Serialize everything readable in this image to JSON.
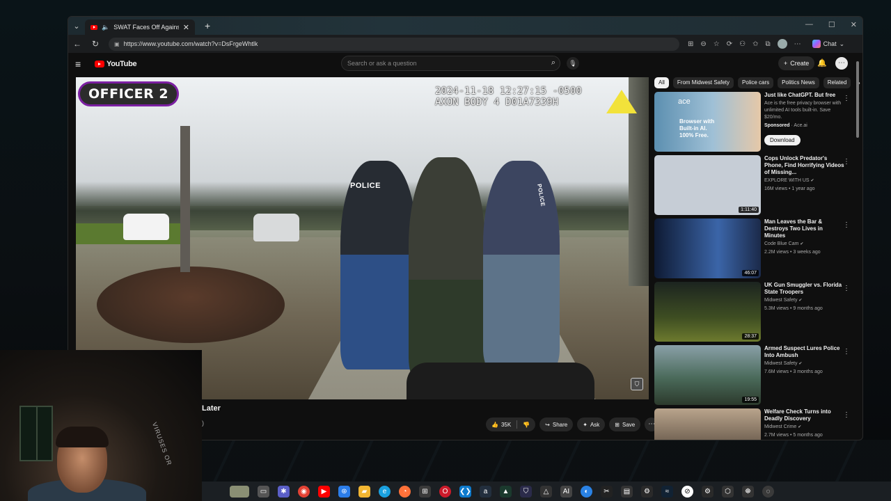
{
  "browser": {
    "tab_title": "SWAT Faces Off Against Killer",
    "tab_close": "✕",
    "new_tab": "+",
    "url": "https://www.youtube.com/watch?v=DsFrgeWhtlk",
    "chat_label": "Chat",
    "window_controls": [
      "—",
      "☐",
      "✕"
    ]
  },
  "youtube": {
    "logo_text": "YouTube",
    "search_placeholder": "Search or ask a question",
    "create_label": "Create"
  },
  "video": {
    "officer_label": "OFFICER 2",
    "timestamp": "2024-11-18 12:27:15 -0500",
    "device": "AXON BODY 4 D01A7339H",
    "vest_label_1": "POLICE",
    "vest_label_2": "POLICE",
    "title_fragment": "Later",
    "subtitle_fragment": ")"
  },
  "actions": {
    "likes": "35K",
    "share": "Share",
    "ask": "Ask",
    "save": "Save"
  },
  "chips": [
    "All",
    "From Midwest Safety",
    "Police cars",
    "Politics News",
    "Related"
  ],
  "ad": {
    "title": "Just like ChatGPT. But free",
    "description": "Ace is the free privacy browser with unlimited AI tools built-in. Save $20/mo.",
    "sponsored": "Sponsored",
    "advertiser": "Ace.ai",
    "brand": "ace",
    "creative_text": "Browser with Built-in AI. 100% Free.",
    "button": "Download"
  },
  "recommendations": [
    {
      "title": "Cops Unlock Predator's Phone, Find Horrifying Videos of Missing...",
      "channel": "EXPLORE WITH US",
      "meta": "16M views • 1 year ago",
      "duration": "1:11:40",
      "thumb_color": "#c6cdd6"
    },
    {
      "title": "Man Leaves the Bar & Destroys Two Lives in Minutes",
      "channel": "Code Blue Cam",
      "meta": "2.2M views • 3 weeks ago",
      "duration": "46:07",
      "thumb_color": "#1b2a4a"
    },
    {
      "title": "UK Gun Smuggler vs. Florida State Troopers",
      "channel": "Midwest Safety",
      "meta": "5.3M views • 9 months ago",
      "duration": "28:37",
      "thumb_color": "#2f3a1f"
    },
    {
      "title": "Armed Suspect Lures Police Into Ambush",
      "channel": "Midwest Safety",
      "meta": "7.6M views • 3 months ago",
      "duration": "19:55",
      "thumb_color": "#4a6a5a"
    },
    {
      "title": "Welfare Check Turns into Deadly Discovery",
      "channel": "Midwest Crime",
      "meta": "2.7M views • 5 months ago",
      "duration": "",
      "thumb_color": "#3a2f26"
    }
  ],
  "webcam": {
    "shirt_text": "VIRUSES OR"
  },
  "icons": {
    "back": "back-arrow-icon",
    "refresh": "refresh-icon",
    "search": "search-icon",
    "mic": "mic-icon",
    "bell": "bell-icon",
    "menu": "hamburger-icon"
  },
  "colors": {
    "yt_red": "#ff0000",
    "badge_border": "#7b1fa2",
    "axon_yellow": "#f2e23a"
  }
}
